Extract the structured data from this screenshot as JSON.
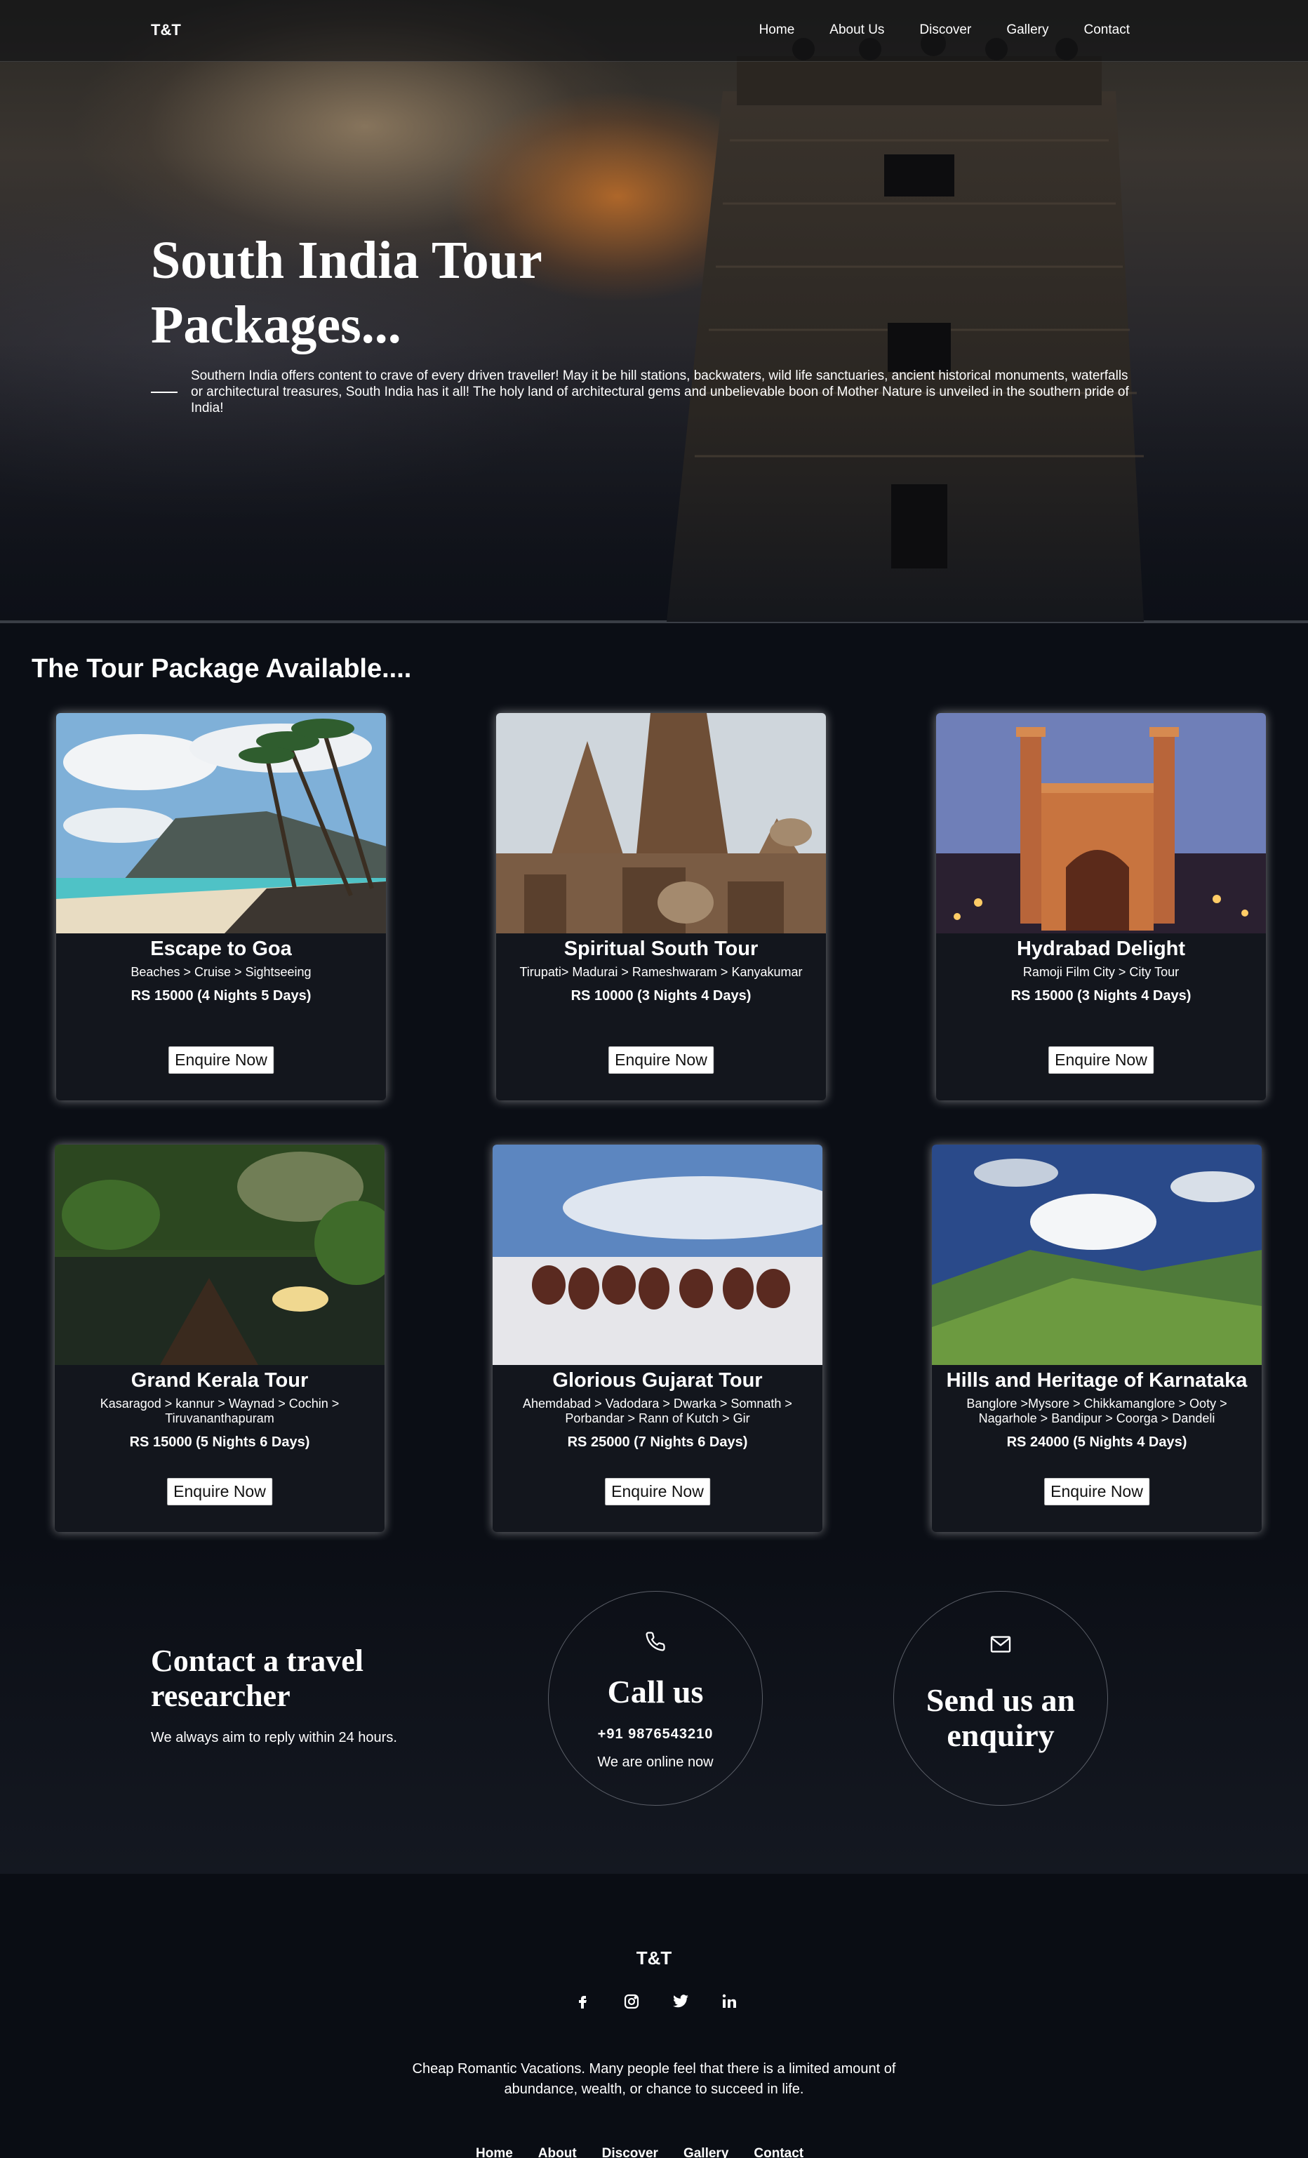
{
  "nav": {
    "logo": "T&T",
    "links": [
      "Home",
      "About Us",
      "Discover",
      "Gallery",
      "Contact"
    ]
  },
  "hero": {
    "title": "South India Tour Packages...",
    "description": "Southern India offers content to crave of every driven traveller! May it be hill stations, backwaters, wild life sanctuaries, ancient historical monuments, waterfalls or architectural treasures, South India has it all! The holy land of architectural gems and unbelievable boon of Mother Nature is unveiled in the southern pride of India!"
  },
  "packages": {
    "heading": "The Tour Package Available....",
    "cards": [
      {
        "title": "Escape to Goa",
        "route": "Beaches > Cruise > Sightseeing",
        "price": "RS 15000 (4 Nights 5 Days)",
        "button": "Enquire Now"
      },
      {
        "title": "Spiritual South Tour",
        "route": "Tirupati> Madurai > Rameshwaram > Kanyakumar",
        "price": "RS 10000 (3 Nights 4 Days)",
        "button": "Enquire Now"
      },
      {
        "title": "Hydrabad Delight",
        "route": "Ramoji Film City > City Tour",
        "price": "RS 15000 (3 Nights 4 Days)",
        "button": "Enquire Now"
      },
      {
        "title": "Grand Kerala Tour",
        "route": "Kasaragod > kannur > Waynad > Cochin > Tiruvananthapuram",
        "price": "RS 15000 (5 Nights 6 Days)",
        "button": "Enquire Now"
      },
      {
        "title": "Glorious Gujarat Tour",
        "route": "Ahemdabad > Vadodara > Dwarka > Somnath > Porbandar > Rann of Kutch > Gir",
        "price": "RS 25000 (7 Nights 6 Days)",
        "button": "Enquire Now"
      },
      {
        "title": "Hills and Heritage of Karnataka",
        "route": "Banglore >Mysore > Chikkamanglore > Ooty > Nagarhole > Bandipur > Coorga > Dandeli",
        "price": "RS 24000 (5 Nights 4 Days)",
        "button": "Enquire Now"
      }
    ]
  },
  "contact": {
    "title": "Contact a travel researcher",
    "subtitle": "We always aim to reply within 24 hours.",
    "call_title": "Call us",
    "phone": "+91 9876543210",
    "online": "We are online now",
    "enquiry_title": "Send us an enquiry"
  },
  "footer": {
    "logo": "T&T",
    "socials": [
      "facebook-icon",
      "instagram-icon",
      "twitter-icon",
      "linkedin-icon"
    ],
    "text": "Cheap Romantic Vacations. Many people feel that there is a limited amount of abundance, wealth, or chance to succeed in life.",
    "links": [
      "Home",
      "About",
      "Discover",
      "Gallery",
      "Contact"
    ]
  }
}
